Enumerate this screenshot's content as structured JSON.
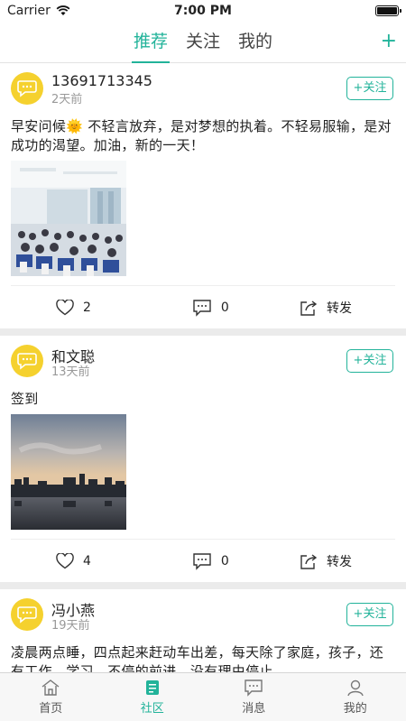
{
  "status": {
    "carrier": "Carrier",
    "time": "7:00 PM"
  },
  "nav": {
    "tabs": [
      {
        "label": "推荐",
        "active": true
      },
      {
        "label": "关注",
        "active": false
      },
      {
        "label": "我的",
        "active": false
      }
    ],
    "add_label": "+"
  },
  "posts": [
    {
      "name": "13691713345",
      "time": "2天前",
      "follow_label": "+关注",
      "content": "早安问候🌞 不轻言放弃，是对梦想的执着。不轻易服输，是对成功的渴望。加油，新的一天！",
      "image": "conference-hall-photo",
      "likes": "2",
      "comments": "0",
      "share_label": "转发"
    },
    {
      "name": "和文聪",
      "time": "13天前",
      "follow_label": "+关注",
      "content": "签到",
      "image": "city-sunset-photo",
      "likes": "4",
      "comments": "0",
      "share_label": "转发"
    },
    {
      "name": "冯小燕",
      "time": "19天前",
      "follow_label": "+关注",
      "content": "凌晨两点睡，四点起来赶动车出差，每天除了家庭，孩子，还有工作，学习，不停的前进，没有理由停止……"
    }
  ],
  "bottom_tabs": [
    {
      "label": "首页",
      "icon": "home-icon",
      "active": false
    },
    {
      "label": "社区",
      "icon": "community-icon",
      "active": true
    },
    {
      "label": "消息",
      "icon": "message-icon",
      "active": false
    },
    {
      "label": "我的",
      "icon": "profile-icon",
      "active": false
    }
  ],
  "colors": {
    "accent": "#22b39a",
    "avatar": "#f5d12e"
  }
}
